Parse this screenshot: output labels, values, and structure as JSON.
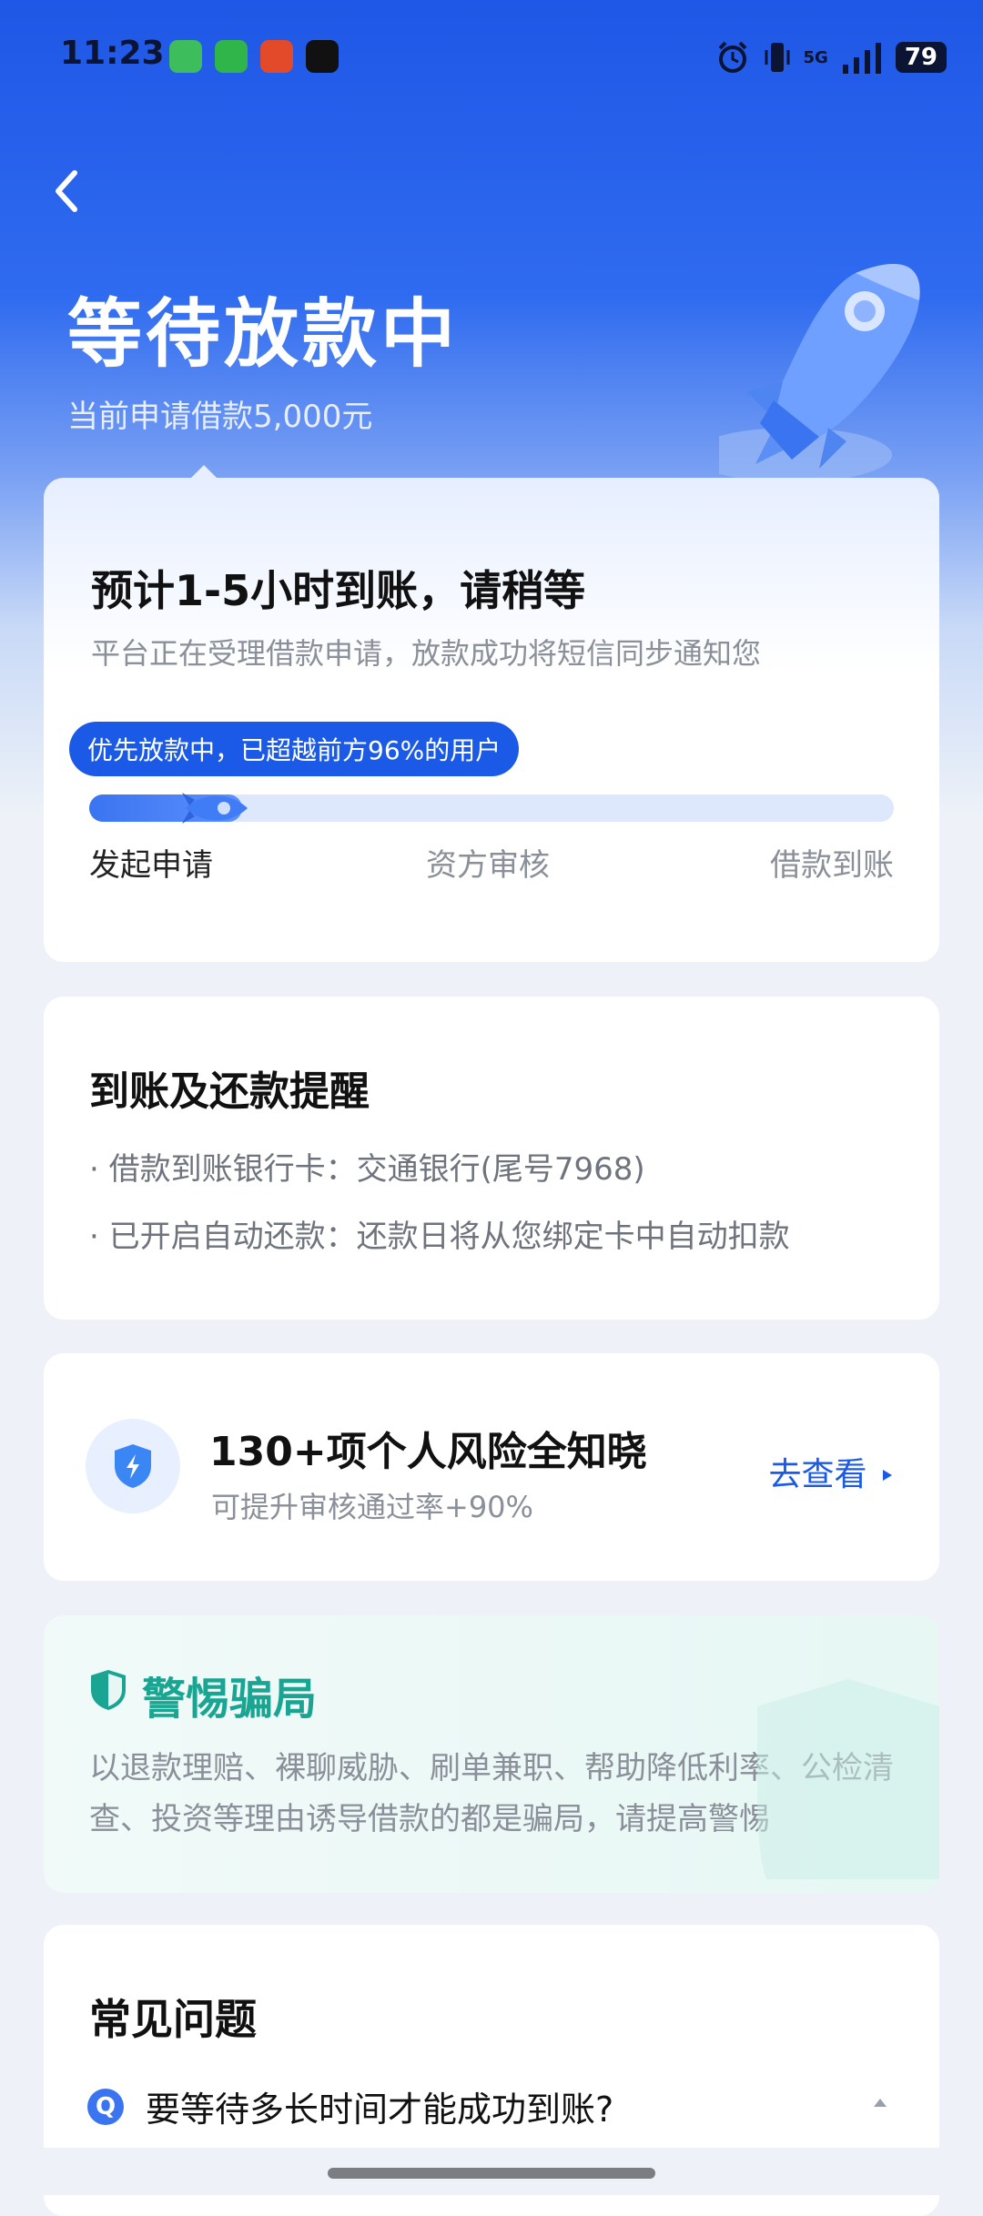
{
  "status_bar": {
    "time": "11:23",
    "network": "5G",
    "battery": "79"
  },
  "header": {
    "title": "等待放款中",
    "subtitle": "当前申请借款5,000元"
  },
  "progress_card": {
    "estimate": "预计1-5小时到账，请稍等",
    "note": "平台正在受理借款申请，放款成功将短信同步通知您",
    "badge": "优先放款中，已超越前方96%的用户",
    "progress_fraction": 0.19,
    "steps": [
      "发起申请",
      "资方审核",
      "借款到账"
    ]
  },
  "reminder_card": {
    "title": "到账及还款提醒",
    "items": [
      "借款到账银行卡：交通银行(尾号7968)",
      "已开启自动还款：还款日将从您绑定卡中自动扣款"
    ]
  },
  "risk_card": {
    "title": "130+项个人风险全知晓",
    "subtitle": "可提升审核通过率+90%",
    "link": "去查看"
  },
  "fraud_card": {
    "title": "警惕骗局",
    "body": "以退款理赔、裸聊威胁、刷单兼职、帮助降低利率、公检清查、投资等理由诱导借款的都是骗局，请提高警惕"
  },
  "faq_card": {
    "title": "常见问题",
    "q_label": "Q",
    "question": "要等待多长时间才能成功到账?"
  },
  "colors": {
    "primary": "#1a5ae6",
    "fraud_green": "#19a591",
    "muted": "#8a8f99"
  }
}
